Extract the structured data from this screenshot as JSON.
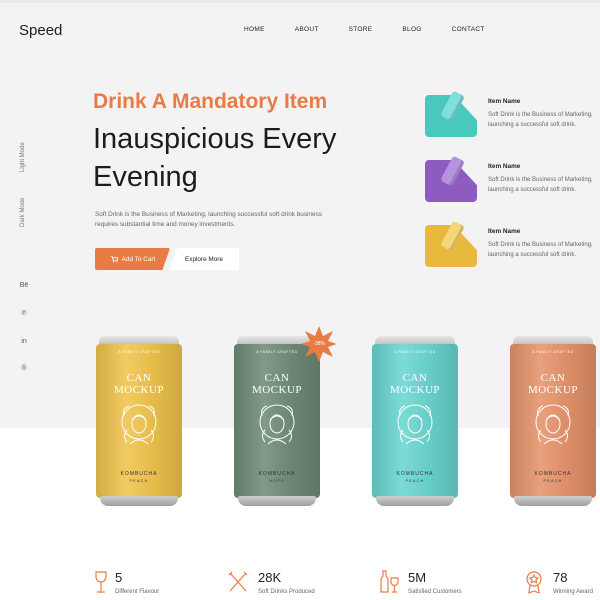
{
  "logo": "Speed",
  "nav": [
    "HOME",
    "ABOUT",
    "STORE",
    "BLOG",
    "CONTACT"
  ],
  "side": {
    "light_mode": "Light Mode",
    "dark_mode": "Dark Mode"
  },
  "social": [
    "Bē",
    "℗",
    "in",
    "®"
  ],
  "hero": {
    "accent_title": "Drink A Mandatory Item",
    "title": "Inauspicious Every Evening",
    "description": "Soft Drink is the Business of Marketing, launching successful soft drink business requires substantial time and money investments.",
    "cart_button": "Add To Cart",
    "more_button": "Explore More"
  },
  "items": [
    {
      "name": "Item Name",
      "text": "Soft Drink is the Business of Marketing, launching a successful soft drink.",
      "color": "#49c9be",
      "can": "#7fe0da"
    },
    {
      "name": "Item Name",
      "text": "Soft Drink is the Business of Marketing, launching a successful soft drink.",
      "color": "#8e5cc0",
      "can": "#b693e0"
    },
    {
      "name": "Item Name",
      "text": "Soft Drink is the Business of Marketing, launching a successful soft drink.",
      "color": "#e8b93a",
      "can": "#f5d77a"
    }
  ],
  "cans": [
    {
      "tiny": "A FAMILY CRAFTED",
      "brand_1": "CAN",
      "brand_2": "MOCKUP",
      "flavour": "KOMBUCHA",
      "sub": "PEACH",
      "color": "#f0c44c"
    },
    {
      "tiny": "A FAMILY CRAFTED",
      "brand_1": "CAN",
      "brand_2": "MOCKUP",
      "flavour": "KOMBUCHA",
      "sub": "HOPS",
      "color": "#6f8c78"
    },
    {
      "tiny": "A FAMILY CRAFTED",
      "brand_1": "CAN",
      "brand_2": "MOCKUP",
      "flavour": "KOMBUCHA",
      "sub": "PEACH",
      "color": "#6ad6d1"
    },
    {
      "tiny": "A FAMILY CRAFTED",
      "brand_1": "CAN",
      "brand_2": "MOCKUP",
      "flavour": "KOMBUCHA",
      "sub": "PEACH",
      "color": "#e6936b"
    }
  ],
  "discount_badge": "-38%",
  "stats": [
    {
      "value": "5",
      "label": "Different Flavour"
    },
    {
      "value": "28K",
      "label": "Soft Drinks Produced"
    },
    {
      "value": "5M",
      "label": "Satisfied Customers"
    },
    {
      "value": "78",
      "label": "Winning Award"
    }
  ],
  "colors": {
    "accent": "#ea7b45",
    "hero_bg": "#f3f3f3"
  }
}
